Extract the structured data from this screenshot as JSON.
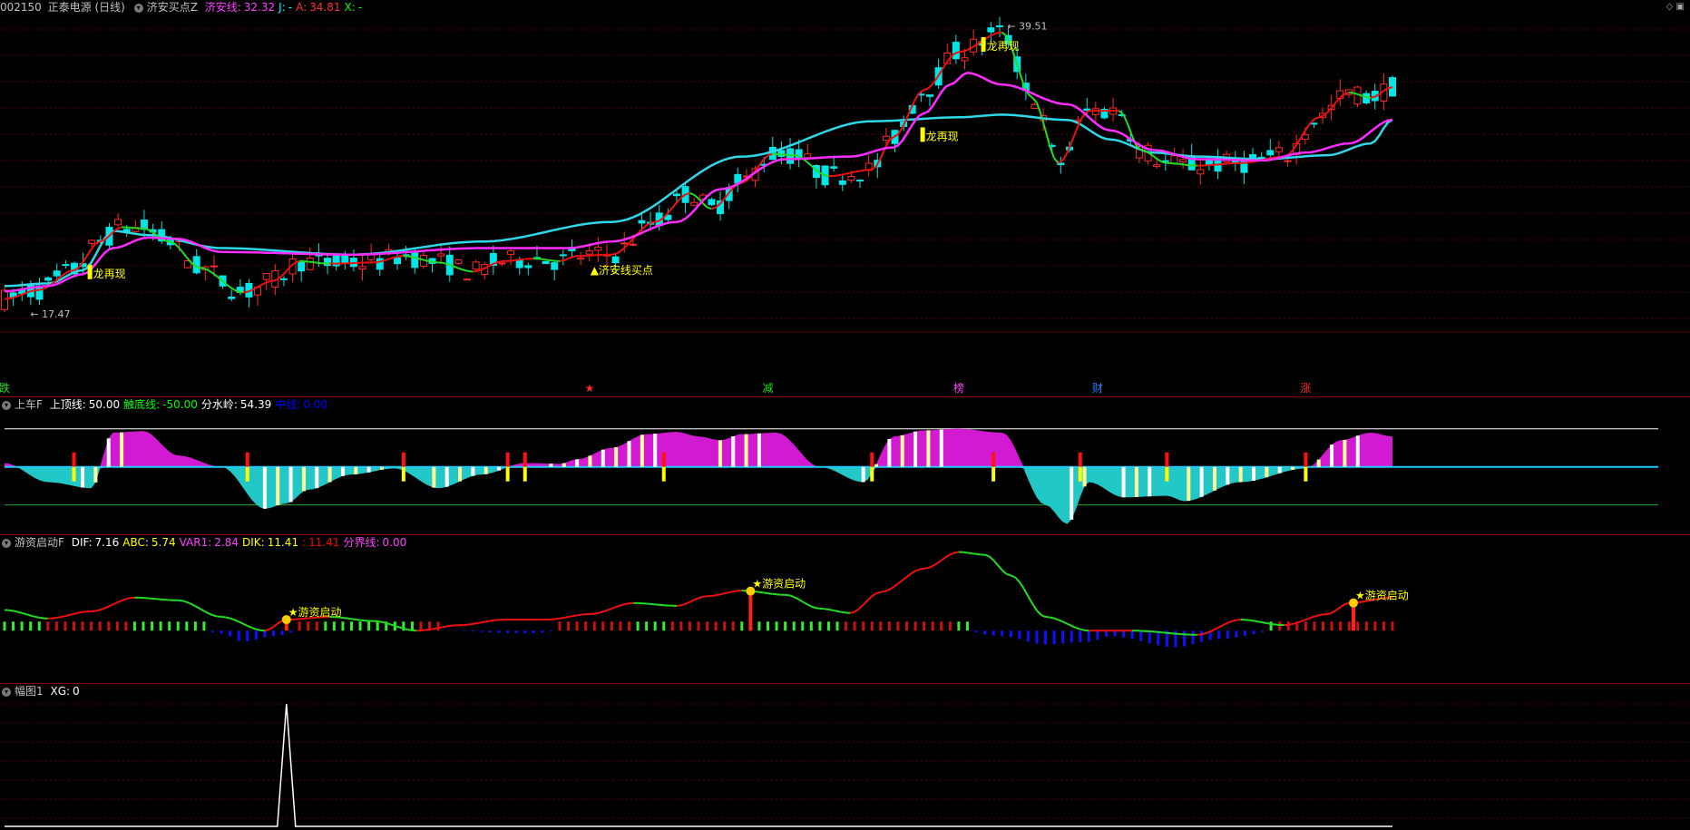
{
  "header": {
    "code": "002150",
    "name": "正泰电源",
    "period": "(日线)",
    "indicator": "济安买点Z",
    "items": [
      {
        "label": "济安线:",
        "value": "32.32",
        "color": "#ff40ff"
      },
      {
        "label": "J:",
        "value": "-",
        "color": "#00ffff"
      },
      {
        "label": "A:",
        "value": "34.81",
        "color": "#ff3030"
      },
      {
        "label": "X:",
        "value": "-",
        "color": "#00ff00"
      }
    ]
  },
  "price_labels": {
    "high": "39.51",
    "low": "17.47"
  },
  "signals": {
    "reappear": "龙再现",
    "buy_point": "济安线买点",
    "hot_money": "游资启动"
  },
  "bottom_marks": [
    "跌",
    "★",
    "减",
    "榜",
    "财",
    "涨"
  ],
  "pane2_header": {
    "name": "上车F",
    "items": [
      {
        "label": "上顶线:",
        "value": "50.00",
        "color": "#ffffff"
      },
      {
        "label": "触底线:",
        "value": "-50.00",
        "color": "#00ff00"
      },
      {
        "label": "分水岭:",
        "value": "54.39",
        "color": "#ffffff"
      },
      {
        "label": "中线:",
        "value": "0.00",
        "color": "#0000ff"
      }
    ]
  },
  "pane3_header": {
    "name": "游资启动F",
    "items": [
      {
        "label": "DIF:",
        "value": "7.16",
        "color": "#ffffff"
      },
      {
        "label": "ABC:",
        "value": "5.74",
        "color": "#ffff00"
      },
      {
        "label": "VAR1:",
        "value": "2.84",
        "color": "#ff40ff"
      },
      {
        "label": "DIK:",
        "value": "11.41",
        "color": "#ffff00"
      },
      {
        "label": ":",
        "value": "11.41",
        "color": "#ff0000"
      },
      {
        "label": "分界线:",
        "value": "0.00",
        "color": "#ff40ff"
      }
    ]
  },
  "pane4_header": {
    "name": "幅图1",
    "items": [
      {
        "label": "XG:",
        "value": "0",
        "color": "#ffffff"
      }
    ]
  },
  "chart_data": [
    {
      "type": "candlestick",
      "title": "济安买点Z",
      "ylim": [
        16.5,
        40.5
      ],
      "n": 160,
      "ma_long_key": [
        [
          0,
          19.6
        ],
        [
          10,
          19.8
        ],
        [
          18,
          20.8
        ],
        [
          25,
          23.8
        ],
        [
          33,
          23.5
        ],
        [
          50,
          22.5
        ],
        [
          80,
          22
        ],
        [
          110,
          23
        ],
        [
          140,
          24.5
        ],
        [
          170,
          29.5
        ],
        [
          200,
          32.2
        ],
        [
          220,
          32.5
        ],
        [
          230,
          32.7
        ],
        [
          245,
          32.3
        ],
        [
          255,
          30.8
        ],
        [
          265,
          29.8
        ],
        [
          275,
          29.5
        ],
        [
          290,
          29.3
        ],
        [
          305,
          29.6
        ],
        [
          315,
          30.5
        ],
        [
          320,
          32.32
        ]
      ],
      "ma_short_key": [
        [
          0,
          19.2
        ],
        [
          10,
          19.6
        ],
        [
          18,
          20.5
        ],
        [
          25,
          22.5
        ],
        [
          33,
          23.3
        ],
        [
          40,
          23.2
        ],
        [
          50,
          22.2
        ],
        [
          80,
          22
        ],
        [
          110,
          22.5
        ],
        [
          130,
          22.5
        ],
        [
          140,
          23
        ],
        [
          155,
          24.5
        ],
        [
          165,
          27
        ],
        [
          180,
          29.3
        ],
        [
          195,
          29.5
        ],
        [
          205,
          30.2
        ],
        [
          212,
          32.8
        ],
        [
          218,
          35
        ],
        [
          222,
          35.9
        ],
        [
          230,
          35
        ],
        [
          245,
          33.5
        ],
        [
          255,
          31.5
        ],
        [
          265,
          30
        ],
        [
          275,
          29.3
        ],
        [
          290,
          29.2
        ],
        [
          300,
          29.8
        ],
        [
          310,
          30.5
        ],
        [
          320,
          32.32
        ]
      ],
      "a_key": [
        [
          0,
          18.6
        ],
        [
          8,
          19.3
        ],
        [
          16,
          20.8
        ],
        [
          22,
          23
        ],
        [
          27,
          24.1
        ],
        [
          32,
          24
        ],
        [
          38,
          23
        ],
        [
          45,
          21
        ],
        [
          55,
          19.1
        ],
        [
          62,
          20
        ],
        [
          68,
          21.5
        ],
        [
          75,
          21.3
        ],
        [
          85,
          21.4
        ],
        [
          92,
          21.9
        ],
        [
          100,
          21.4
        ],
        [
          108,
          20.7
        ],
        [
          115,
          21.5
        ],
        [
          122,
          21.7
        ],
        [
          128,
          21.5
        ],
        [
          132,
          21.9
        ],
        [
          140,
          22
        ],
        [
          150,
          24.5
        ],
        [
          158,
          26.7
        ],
        [
          163,
          25.5
        ],
        [
          170,
          27.5
        ],
        [
          177,
          29.7
        ],
        [
          182,
          29.6
        ],
        [
          190,
          28
        ],
        [
          200,
          28.5
        ],
        [
          205,
          31
        ],
        [
          212,
          34.6
        ],
        [
          220,
          37.5
        ],
        [
          230,
          39
        ],
        [
          237,
          34
        ],
        [
          243,
          29
        ],
        [
          250,
          33
        ],
        [
          257,
          33
        ],
        [
          262,
          30
        ],
        [
          268,
          29
        ],
        [
          275,
          28.8
        ],
        [
          285,
          29
        ],
        [
          295,
          29.5
        ],
        [
          303,
          32.5
        ],
        [
          310,
          34.4
        ],
        [
          315,
          34
        ],
        [
          320,
          34.81
        ]
      ],
      "price_high_index": 227,
      "price_low_index": 3
    },
    {
      "type": "area",
      "title": "上车F",
      "ylim": [
        -85,
        70
      ],
      "series_key": [
        [
          0,
          5
        ],
        [
          10,
          -20
        ],
        [
          20,
          -28
        ],
        [
          25,
          45
        ],
        [
          32,
          47
        ],
        [
          40,
          15
        ],
        [
          50,
          0
        ],
        [
          60,
          -55
        ],
        [
          65,
          -48
        ],
        [
          70,
          -30
        ],
        [
          80,
          -10
        ],
        [
          90,
          -2
        ],
        [
          100,
          -28
        ],
        [
          110,
          -10
        ],
        [
          120,
          5
        ],
        [
          128,
          4
        ],
        [
          132,
          10
        ],
        [
          140,
          25
        ],
        [
          148,
          43
        ],
        [
          155,
          46
        ],
        [
          160,
          40
        ],
        [
          165,
          35
        ],
        [
          170,
          43
        ],
        [
          178,
          45
        ],
        [
          188,
          0
        ],
        [
          198,
          -20
        ],
        [
          205,
          40
        ],
        [
          212,
          48
        ],
        [
          220,
          50
        ],
        [
          230,
          45
        ],
        [
          240,
          -50
        ],
        [
          245,
          -75
        ],
        [
          250,
          -20
        ],
        [
          258,
          -40
        ],
        [
          268,
          -38
        ],
        [
          272,
          -45
        ],
        [
          285,
          -20
        ],
        [
          300,
          -2
        ],
        [
          308,
          35
        ],
        [
          315,
          45
        ],
        [
          320,
          40
        ]
      ],
      "upper_line": 50,
      "lower_line": -50,
      "zero_line": 0,
      "markers": [
        20,
        70,
        115,
        145,
        150,
        190,
        250,
        285,
        310,
        335,
        375
      ]
    },
    {
      "type": "line+bar",
      "title": "游资启动F",
      "ylim": [
        -18,
        30
      ],
      "line_key": [
        [
          0,
          7.5
        ],
        [
          10,
          4.4
        ],
        [
          20,
          7
        ],
        [
          30,
          12
        ],
        [
          40,
          11
        ],
        [
          50,
          5
        ],
        [
          60,
          0
        ],
        [
          65,
          4
        ],
        [
          75,
          5
        ],
        [
          85,
          3.5
        ],
        [
          95,
          0
        ],
        [
          105,
          2
        ],
        [
          115,
          4
        ],
        [
          125,
          4
        ],
        [
          135,
          6
        ],
        [
          145,
          10
        ],
        [
          155,
          9
        ],
        [
          162,
          12.5
        ],
        [
          170,
          14.5
        ],
        [
          180,
          13
        ],
        [
          188,
          8
        ],
        [
          195,
          6.4
        ],
        [
          202,
          14
        ],
        [
          212,
          22.5
        ],
        [
          220,
          28.5
        ],
        [
          226,
          27.5
        ],
        [
          232,
          20
        ],
        [
          240,
          5
        ],
        [
          250,
          0
        ],
        [
          260,
          0
        ],
        [
          275,
          -1.5
        ],
        [
          285,
          4
        ],
        [
          295,
          2
        ],
        [
          305,
          6
        ],
        [
          310,
          10
        ],
        [
          320,
          12
        ]
      ],
      "bars_key": [
        [
          0,
          3
        ],
        [
          40,
          3
        ],
        [
          50,
          -1
        ],
        [
          55,
          -4
        ],
        [
          62,
          -2
        ],
        [
          70,
          0.8
        ],
        [
          100,
          0
        ],
        [
          120,
          -1
        ],
        [
          140,
          2
        ],
        [
          150,
          3
        ],
        [
          170,
          3
        ],
        [
          200,
          0
        ],
        [
          215,
          2
        ],
        [
          230,
          -2
        ],
        [
          240,
          -5
        ],
        [
          250,
          -4
        ],
        [
          255,
          -2
        ],
        [
          270,
          -6
        ],
        [
          280,
          -3
        ],
        [
          300,
          2
        ],
        [
          320,
          3
        ]
      ],
      "start_signals": [
        65,
        172,
        311
      ]
    },
    {
      "type": "line",
      "title": "幅图1",
      "ylim": [
        0,
        1
      ],
      "series": [
        {
          "name": "XG",
          "spike_index": 65
        }
      ]
    }
  ],
  "colors": {
    "up": "#ff2a2a",
    "down": "#00e5e5",
    "jiAn": "#ff2cff",
    "longLine": "#2fd8e8",
    "green": "#22dd22",
    "red": "#ee1111",
    "yellow": "#ffff00",
    "magenta": "#d21ad2",
    "cyanFill": "#22c8c8",
    "barRed": "#cc1111",
    "barBlue": "#1010ff",
    "barGreen": "#33ee33"
  }
}
